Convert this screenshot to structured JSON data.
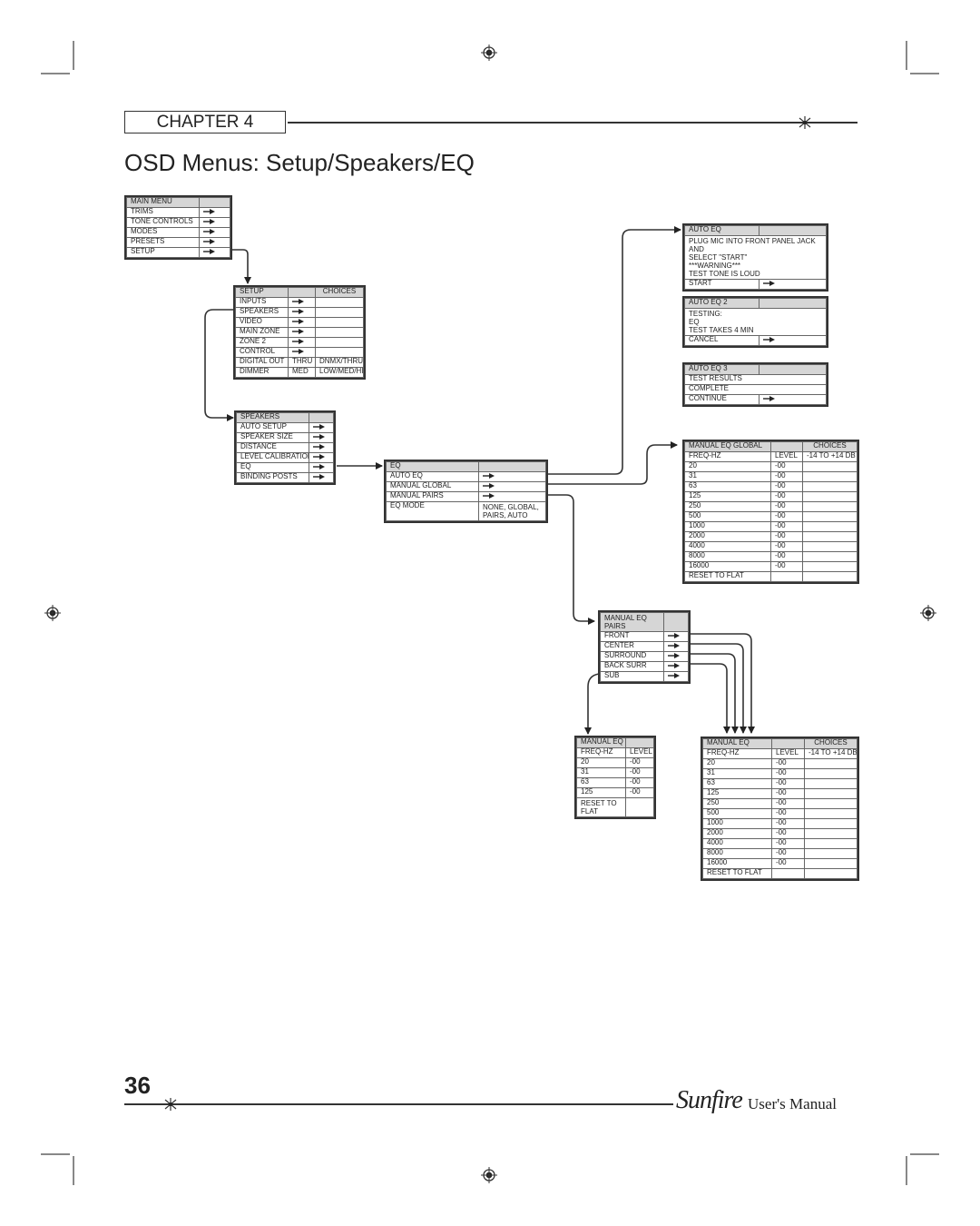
{
  "header": {
    "chapter_label": "CHAPTER 4",
    "page_title": "OSD Menus: Setup/Speakers/EQ"
  },
  "footer": {
    "page_number": "36",
    "brand": "Sunfire",
    "manual_label": "User's Manual"
  },
  "menus": {
    "main_menu": {
      "title": "MAIN MENU",
      "rows": [
        {
          "label": "TRIMS",
          "arrow": true
        },
        {
          "label": "TONE CONTROLS",
          "arrow": true
        },
        {
          "label": "MODES",
          "arrow": true
        },
        {
          "label": "PRESETS",
          "arrow": true
        },
        {
          "label": "SETUP",
          "arrow": true
        }
      ]
    },
    "setup": {
      "title": "SETUP",
      "choices_header": "CHOICES",
      "rows": [
        {
          "label": "INPUTS",
          "value": "",
          "choices": ""
        },
        {
          "label": "SPEAKERS",
          "value": "",
          "choices": ""
        },
        {
          "label": "VIDEO",
          "value": "",
          "choices": ""
        },
        {
          "label": "MAIN ZONE",
          "value": "",
          "choices": ""
        },
        {
          "label": "ZONE 2",
          "value": "",
          "choices": ""
        },
        {
          "label": "CONTROL",
          "value": "",
          "choices": ""
        },
        {
          "label": "DIGITAL OUT",
          "value": "THRU",
          "choices": "DNMX/THRU"
        },
        {
          "label": "DIMMER",
          "value": "MED",
          "choices": "LOW/MED/HI"
        }
      ]
    },
    "speakers": {
      "title": "SPEAKERS",
      "rows": [
        {
          "label": "AUTO SETUP"
        },
        {
          "label": "SPEAKER SIZE"
        },
        {
          "label": "DISTANCE"
        },
        {
          "label": "LEVEL CALIBRATION"
        },
        {
          "label": "EQ"
        },
        {
          "label": "BINDING POSTS"
        }
      ]
    },
    "eq": {
      "title": "EQ",
      "rows": [
        {
          "label": "AUTO EQ",
          "value": ""
        },
        {
          "label": "MANUAL GLOBAL",
          "value": ""
        },
        {
          "label": "MANUAL PAIRS",
          "value": ""
        },
        {
          "label": "EQ MODE",
          "value": "NONE, GLOBAL, PAIRS, AUTO"
        }
      ]
    },
    "auto_eq": {
      "title": "AUTO EQ",
      "message": [
        "PLUG MIC INTO FRONT PANEL JACK AND",
        "SELECT \"START\"",
        "***WARNING***",
        "TEST TONE IS LOUD"
      ],
      "action": "START"
    },
    "auto_eq_2": {
      "title": "AUTO EQ 2",
      "message": [
        "TESTING:",
        "EQ",
        "TEST TAKES 4 MIN"
      ],
      "action": "CANCEL"
    },
    "auto_eq_3": {
      "title": "AUTO EQ 3",
      "rows": [
        "TEST RESULTS",
        "COMPLETE"
      ],
      "action": "CONTINUE"
    },
    "manual_eq_global": {
      "title": "MANUAL EQ GLOBAL",
      "choices_header": "CHOICES",
      "col_freq": "FREQ-HZ",
      "col_level": "LEVEL",
      "choices": "-14 TO +14 DB",
      "rows": [
        {
          "freq": "20",
          "level": "-00"
        },
        {
          "freq": "31",
          "level": "-00"
        },
        {
          "freq": "63",
          "level": "-00"
        },
        {
          "freq": "125",
          "level": "-00"
        },
        {
          "freq": "250",
          "level": "-00"
        },
        {
          "freq": "500",
          "level": "-00"
        },
        {
          "freq": "1000",
          "level": "-00"
        },
        {
          "freq": "2000",
          "level": "-00"
        },
        {
          "freq": "4000",
          "level": "-00"
        },
        {
          "freq": "8000",
          "level": "-00"
        },
        {
          "freq": "16000",
          "level": "-00"
        }
      ],
      "reset": "RESET TO FLAT"
    },
    "manual_eq_pairs": {
      "title": "MANUAL EQ PAIRS",
      "rows": [
        {
          "label": "FRONT"
        },
        {
          "label": "CENTER"
        },
        {
          "label": "SURROUND"
        },
        {
          "label": "BACK SURR"
        },
        {
          "label": "SUB"
        }
      ]
    },
    "manual_eq_sub": {
      "title": "MANUAL EQ",
      "col_freq": "FREQ-HZ",
      "col_level": "LEVEL",
      "rows": [
        {
          "freq": "20",
          "level": "-00"
        },
        {
          "freq": "31",
          "level": "-00"
        },
        {
          "freq": "63",
          "level": "-00"
        },
        {
          "freq": "125",
          "level": "-00"
        }
      ],
      "reset": "RESET TO FLAT"
    },
    "manual_eq_pair": {
      "title": "MANUAL EQ",
      "choices_header": "CHOICES",
      "col_freq": "FREQ-HZ",
      "col_level": "LEVEL",
      "choices": "-14 TO +14 DB",
      "rows": [
        {
          "freq": "20",
          "level": "-00"
        },
        {
          "freq": "31",
          "level": "-00"
        },
        {
          "freq": "63",
          "level": "-00"
        },
        {
          "freq": "125",
          "level": "-00"
        },
        {
          "freq": "250",
          "level": "-00"
        },
        {
          "freq": "500",
          "level": "-00"
        },
        {
          "freq": "1000",
          "level": "-00"
        },
        {
          "freq": "2000",
          "level": "-00"
        },
        {
          "freq": "4000",
          "level": "-00"
        },
        {
          "freq": "8000",
          "level": "-00"
        },
        {
          "freq": "16000",
          "level": "-00"
        }
      ],
      "reset": "RESET TO FLAT"
    }
  }
}
